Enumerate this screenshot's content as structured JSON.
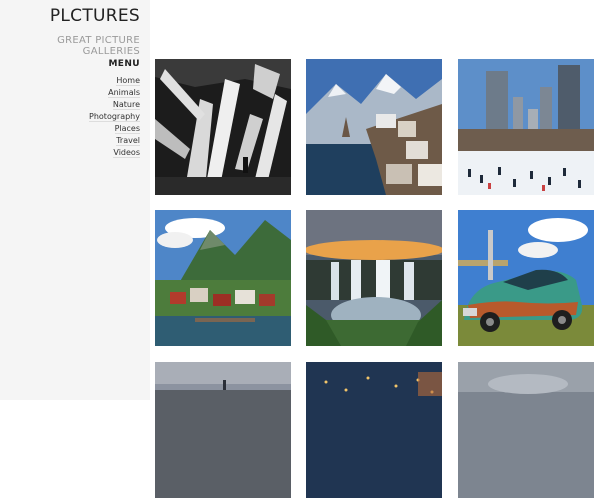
{
  "site": {
    "logo": "PLCTURES",
    "tagline": "GREAT PICTURE GALLERIES"
  },
  "menu": {
    "title": "MENU",
    "items": [
      {
        "label": "Home"
      },
      {
        "label": "Animals"
      },
      {
        "label": "Nature"
      },
      {
        "label": "Photography"
      },
      {
        "label": "Places"
      },
      {
        "label": "Travel"
      },
      {
        "label": "Videos"
      }
    ]
  },
  "gallery": {
    "images": [
      {
        "subject": "crystal cave"
      },
      {
        "subject": "alpine lake village"
      },
      {
        "subject": "snowy city park skyline"
      },
      {
        "subject": "fjord village"
      },
      {
        "subject": "waterfall at sunset"
      },
      {
        "subject": "rusty vintage car"
      },
      {
        "subject": "city skyline tower"
      },
      {
        "subject": "city lights at night"
      },
      {
        "subject": "misty landscape"
      }
    ]
  }
}
